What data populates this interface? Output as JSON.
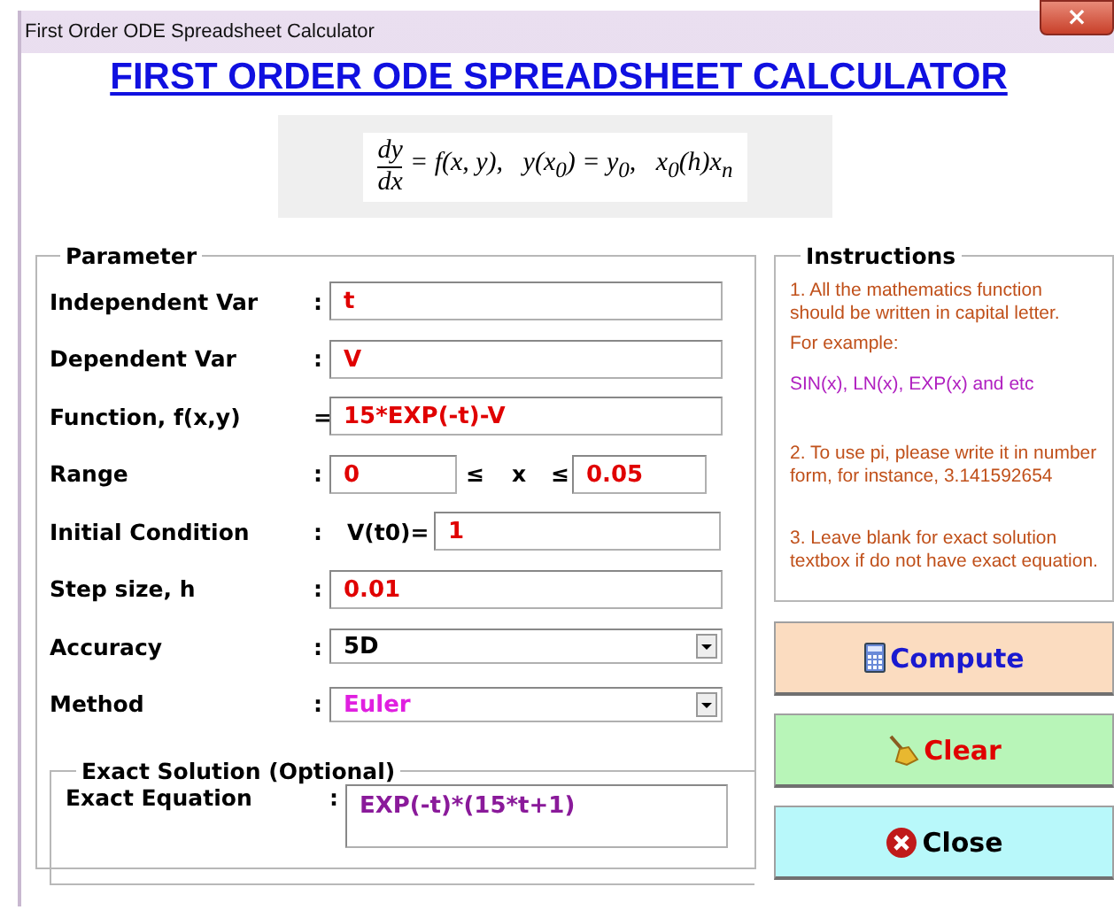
{
  "window": {
    "title": "First Order ODE Spreadsheet Calculator",
    "close": "×"
  },
  "heading": "FIRST ORDER ODE SPREADSHEET CALCULATOR",
  "formula": {
    "numerator": "dy",
    "denominator": "dx",
    "rest": "= f(x, y),   y(x$_{0}$) = y$_{0}$,   x$_{0}$(h)x$_{n}$"
  },
  "parameter": {
    "title": "Parameter",
    "rows": [
      {
        "kind": "text",
        "label": "Independent Var",
        "sep": ":",
        "value": "t",
        "color": "#e00000"
      },
      {
        "kind": "text",
        "label": "Dependent Var",
        "sep": ":",
        "value": "V",
        "color": "#e00000"
      },
      {
        "kind": "text",
        "label": "Function, f(x,y)",
        "sep": "=",
        "value": "15*EXP(-t)-V",
        "color": "#e00000"
      },
      {
        "kind": "range",
        "label": "Range",
        "sep": ":",
        "value": "0",
        "le1": "≤",
        "var": "x",
        "le2": "≤",
        "value2": "0.05",
        "color": "#e00000"
      },
      {
        "kind": "initial",
        "label": "Initial Condition",
        "sep": ":",
        "prefix": "V(t0)=",
        "value": "1",
        "color": "#e00000"
      },
      {
        "kind": "text",
        "label": "Step size, h",
        "sep": ":",
        "value": "0.01",
        "color": "#e00000"
      },
      {
        "kind": "select",
        "label": "Accuracy",
        "sep": ":",
        "value": "5D",
        "color": "#000000"
      },
      {
        "kind": "select",
        "label": "Method",
        "sep": ":",
        "value": "Euler",
        "color": "#e020e0"
      }
    ],
    "exact": {
      "title": "Exact Solution (Optional)",
      "label": "Exact Equation",
      "sep": ":",
      "value": "EXP(-t)*(15*t+1)",
      "color": "#8a1a9a"
    }
  },
  "instructions": {
    "title": "Instructions",
    "items": [
      {
        "text": "1. All the mathematics function should be written in capital letter.",
        "color": "#c0501a"
      },
      {
        "text": "For example:",
        "color": "#c0501a"
      },
      {
        "text": "SIN(x), LN(x), EXP(x) and etc",
        "color": "#b020c0"
      },
      {
        "text": "2. To use pi, please write it in number form, for instance, 3.141592654",
        "color": "#c0501a"
      },
      {
        "text": "3. Leave blank for exact solution textbox if do not have exact equation.",
        "color": "#c0501a"
      }
    ]
  },
  "buttons": [
    {
      "kind": "compute",
      "label": "Compute"
    },
    {
      "kind": "clear",
      "label": "Clear"
    },
    {
      "kind": "close",
      "label": "Close"
    }
  ]
}
